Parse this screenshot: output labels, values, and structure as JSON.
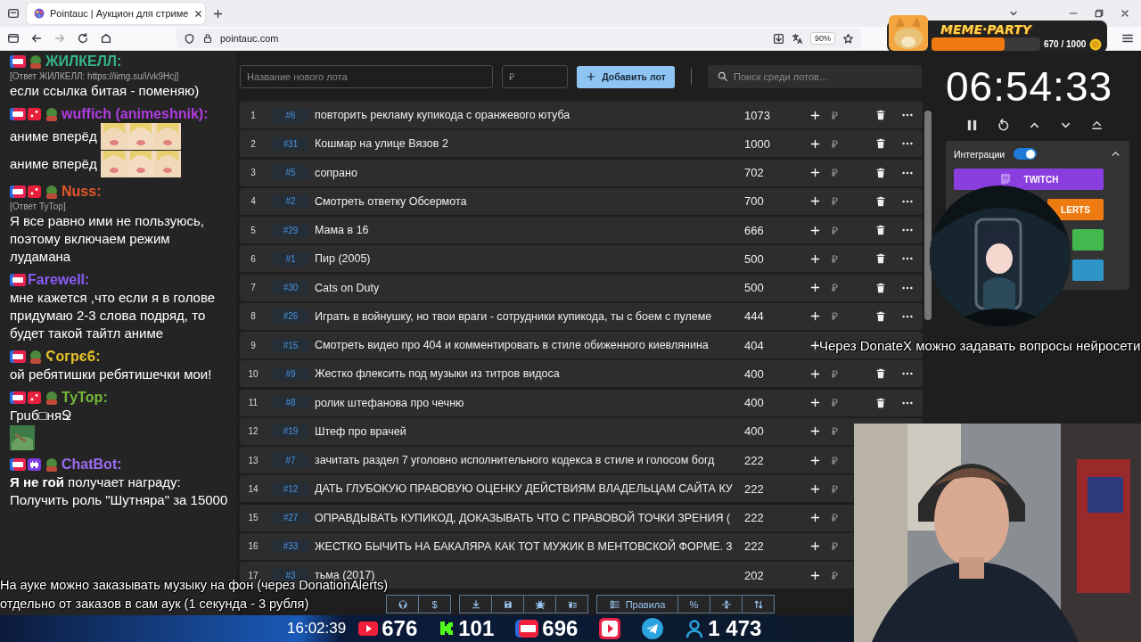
{
  "browser": {
    "tab_title": "Pointauc | Аукцион для стриме",
    "url": "pointauc.com",
    "zoom": "90%"
  },
  "overlay": {
    "brand": "MEME·PARTY",
    "progress_text": "670 / 1000",
    "level": 0.67
  },
  "chat": [
    {
      "badges": [
        {
          "kind": "live"
        },
        {
          "kind": "avatar"
        }
      ],
      "user": "ЖИЛКЕЛЛ:",
      "color": "#35b38a",
      "reply": "[Ответ ЖИЛКЕЛЛ: https://iimg.su/i/vk9Hcj]",
      "lines": [
        {
          "text": "если ссылка битая - поменяю)"
        }
      ]
    },
    {
      "badges": [
        {
          "kind": "live"
        },
        {
          "kind": "dice"
        },
        {
          "kind": "avatar"
        }
      ],
      "user": "wuffich (animeshnik):",
      "color": "#b13ce0",
      "lines": [
        {
          "text": "аниме вперёд",
          "emote": true
        },
        {
          "text": "аниме вперёд",
          "emote": true
        }
      ]
    },
    {
      "badges": [
        {
          "kind": "live"
        },
        {
          "kind": "dice"
        },
        {
          "kind": "avatar"
        }
      ],
      "user": "Nuss:",
      "color": "#e0582c",
      "reply": "[Ответ ТуТор]",
      "lines": [
        {
          "text": "Я все равно ими не пользуюсь, поэтому включаем режим лудамана"
        }
      ]
    },
    {
      "badges": [
        {
          "kind": "live"
        }
      ],
      "user": "Farewell:",
      "color": "#8a5cf5",
      "lines": [
        {
          "text": "мне кажется ,что если я в голове придумаю 2-3 слова подряд, то будет такой тайтл аниме"
        }
      ]
    },
    {
      "badges": [
        {
          "kind": "live"
        },
        {
          "kind": "avatar"
        }
      ],
      "user": "Ϛогрєϐ:",
      "color": "#e6c12a",
      "lines": [
        {
          "text": "ой ребятишки ребятишечки мои!"
        }
      ]
    },
    {
      "badges": [
        {
          "kind": "live"
        },
        {
          "kind": "dice"
        },
        {
          "kind": "avatar"
        }
      ],
      "user": "ТуТор:",
      "color": "#76b83a",
      "lines": [
        {
          "text": "Грuб□няՋ"
        },
        {
          "emote": true
        }
      ]
    },
    {
      "badges": [
        {
          "kind": "live"
        },
        {
          "kind": "invader"
        },
        {
          "kind": "avatar"
        }
      ],
      "user": "ChatBot:",
      "color": "#9b6cf0",
      "lines": [
        {
          "text": "**Я не гой** получает награду: Получить роль \"Шутняра\" за 15000"
        }
      ]
    }
  ],
  "lot_form": {
    "name_placeholder": "Название нового лота",
    "amount_placeholder": "₽",
    "add_button": "Добавить лот",
    "search_placeholder": "Поиск среди лотов..."
  },
  "lots": [
    {
      "n": "1",
      "id": "#6",
      "name": "повторить рекламу купикода с оранжевого ютуба",
      "amount": "1073",
      "currency": "₽",
      "menu": true
    },
    {
      "n": "2",
      "id": "#31",
      "name": "Кошмар на улице Вязов 2",
      "amount": "1000",
      "currency": "₽",
      "menu": true
    },
    {
      "n": "3",
      "id": "#5",
      "name": "сопрано",
      "amount": "702",
      "currency": "₽",
      "menu": true
    },
    {
      "n": "4",
      "id": "#2",
      "name": "Смотреть ответку Обсермота",
      "amount": "700",
      "currency": "₽",
      "menu": true
    },
    {
      "n": "5",
      "id": "#29",
      "name": "Мама в 16",
      "amount": "666",
      "currency": "₽",
      "menu": true
    },
    {
      "n": "6",
      "id": "#1",
      "name": "Пир (2005)",
      "amount": "500",
      "currency": "₽",
      "menu": true
    },
    {
      "n": "7",
      "id": "#30",
      "name": "Cats on Duty",
      "amount": "500",
      "currency": "₽",
      "menu": true
    },
    {
      "n": "8",
      "id": "#26",
      "name": "Играть в войнушку, но твои враги - сотрудники купикода, ты с боем с пулеме",
      "amount": "444",
      "currency": "₽",
      "menu": true
    },
    {
      "n": "9",
      "id": "#15",
      "name": "Смотреть видео про 404 и комментировать в стиле обиженного киевлянина",
      "amount": "404",
      "menu": false
    },
    {
      "n": "10",
      "id": "#9",
      "name": "Жестко флексить под музыки из титров видоса",
      "amount": "400",
      "currency": "₽",
      "menu": true
    },
    {
      "n": "11",
      "id": "#8",
      "name": "ролик штефанова про чечню",
      "amount": "400",
      "currency": "₽",
      "menu": true
    },
    {
      "n": "12",
      "id": "#19",
      "name": "Штеф про врачей",
      "amount": "400",
      "currency": "₽",
      "menu": false
    },
    {
      "n": "13",
      "id": "#7",
      "name": "зачитать раздел 7 уголовно исполнительного кодекса в стиле и голосом богд",
      "amount": "222",
      "currency": "₽",
      "menu": false
    },
    {
      "n": "14",
      "id": "#12",
      "name": "ДАТЬ ГЛУБОКУЮ ПРАВОВУЮ ОЦЕНКУ ДЕЙСТВИЯМ ВЛАДЕЛЬЦАМ САЙТА КУ",
      "amount": "222",
      "currency": "₽",
      "menu": false
    },
    {
      "n": "15",
      "id": "#27",
      "name": "ОПРАВДЫВАТЬ КУПИКОД, ДОКАЗЫВАТЬ ЧТО С ПРАВОВОЙ ТОЧКИ ЗРЕНИЯ (",
      "amount": "222",
      "currency": "₽",
      "menu": false
    },
    {
      "n": "16",
      "id": "#33",
      "name": "ЖЕСТКО БЫЧИТЬ НА БАКАЛЯРА КАК ТОТ МУЖИК В МЕНТОВСКОЙ ФОРМЕ. 3",
      "amount": "222",
      "currency": "₽",
      "menu": false
    },
    {
      "n": "17",
      "id": "#3",
      "name": "тьма (2017)",
      "amount": "202",
      "currency": "₽",
      "menu": false
    }
  ],
  "toolbar": [
    [
      {
        "kind": "github"
      },
      {
        "kind": "text",
        "label": "$"
      }
    ],
    [
      {
        "kind": "download"
      },
      {
        "kind": "save"
      },
      {
        "kind": "bug"
      },
      {
        "kind": "clear"
      }
    ],
    [
      {
        "kind": "rules",
        "label": "Правила"
      },
      {
        "kind": "text",
        "label": "%"
      },
      {
        "kind": "split"
      },
      {
        "kind": "sort"
      }
    ]
  ],
  "timer": "06:54:33",
  "integrations": {
    "label": "Интеграции",
    "on": true,
    "buttons": [
      {
        "kind": "twitch",
        "label": "TWITCH",
        "color": "#8a3ee0"
      },
      {
        "kind": "alerts",
        "label": "LERTS",
        "color": "#ee7b12"
      },
      {
        "kind": "plain",
        "color": "#43b84e"
      },
      {
        "kind": "plain",
        "color": "#2f95c8"
      }
    ]
  },
  "captions": {
    "donatex": "Через DonateX можно задавать вопросы нейросети",
    "music": [
      "На ауке можно заказывать музыку на фон (через DonationAlerts)",
      "отдельно от заказов в сам аук (1 секунда - 3 рубля)"
    ]
  },
  "stream_bar": {
    "time": "16:02:39",
    "stats": [
      {
        "kind": "youtube",
        "value": "676"
      },
      {
        "kind": "kick",
        "value": "101"
      },
      {
        "kind": "vklive",
        "value": "696"
      },
      {
        "kind": "rutube"
      },
      {
        "kind": "telegram"
      },
      {
        "kind": "viewers",
        "value": "1 473"
      }
    ]
  }
}
